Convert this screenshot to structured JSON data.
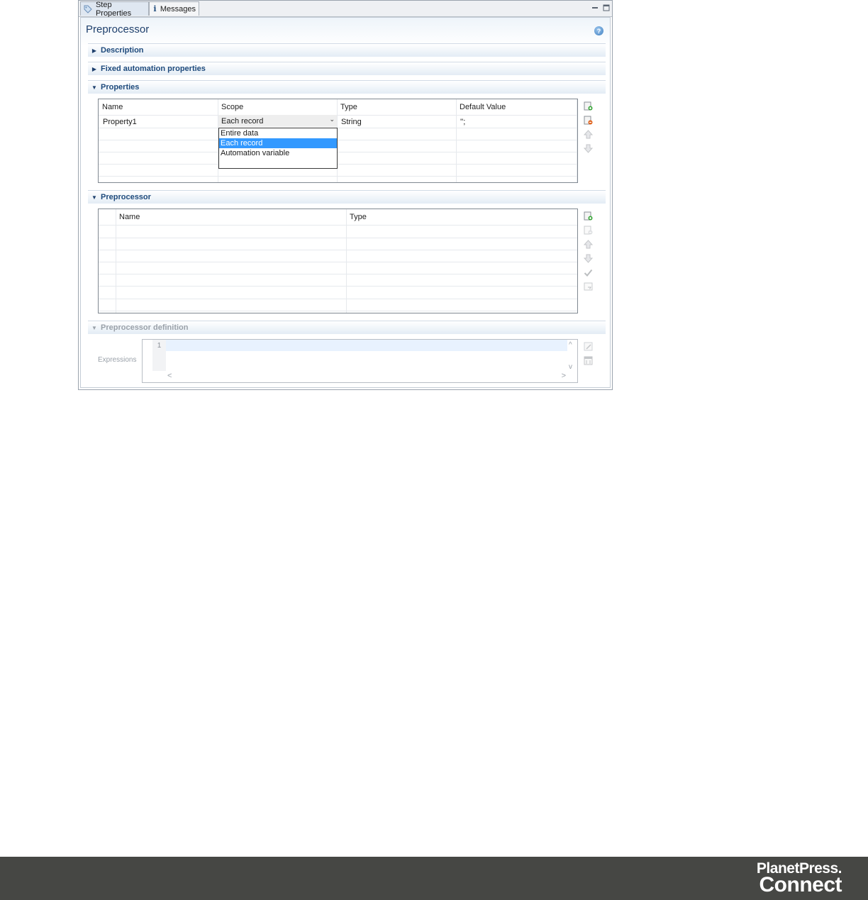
{
  "tabs": [
    {
      "label": "Step Properties",
      "icon": "tag-icon",
      "active": true
    },
    {
      "label": "Messages",
      "icon": "info-icon",
      "active": false
    }
  ],
  "window_controls": {
    "minimize": "minimize-icon",
    "maximize": "maximize-icon"
  },
  "form": {
    "title": "Preprocessor",
    "help_icon": "help-icon",
    "help_glyph": "?"
  },
  "sections": {
    "description": "Description",
    "fixed": "Fixed automation properties",
    "properties": "Properties",
    "preprocessor": "Preprocessor",
    "definition": "Preprocessor definition"
  },
  "properties_table": {
    "columns": [
      "Name",
      "Scope",
      "Type",
      "Default Value"
    ],
    "rows": [
      {
        "name": "Property1",
        "scope": "Each record",
        "type": "String",
        "default": "'';"
      }
    ],
    "scope_options": [
      "Entire data",
      "Each record",
      "Automation variable"
    ],
    "scope_selected": "Each record",
    "combo_arrow": "⌄"
  },
  "properties_tools": [
    "add-row-icon",
    "delete-row-icon",
    "move-up-icon",
    "move-down-icon"
  ],
  "preprocessor_table": {
    "columns": [
      "Name",
      "Type"
    ],
    "rows": []
  },
  "preprocessor_tools": [
    "add-row-icon",
    "delete-row-icon",
    "move-up-icon",
    "move-down-icon",
    "check-icon",
    "edit-script-icon"
  ],
  "definition": {
    "expression_label": "Expressions",
    "line_number": "1",
    "scroll_up": "^",
    "scroll_down": "v",
    "scroll_left": "<",
    "scroll_right": ">"
  },
  "definition_tools": [
    "edit-expression-icon",
    "expression-builder-icon"
  ],
  "footer": {
    "brand_line1": "PlanetPress.",
    "brand_line2": "Connect"
  },
  "colors": {
    "accent": "#1e4a7c",
    "selection": "#3399ff",
    "footer_bg": "#464744"
  }
}
